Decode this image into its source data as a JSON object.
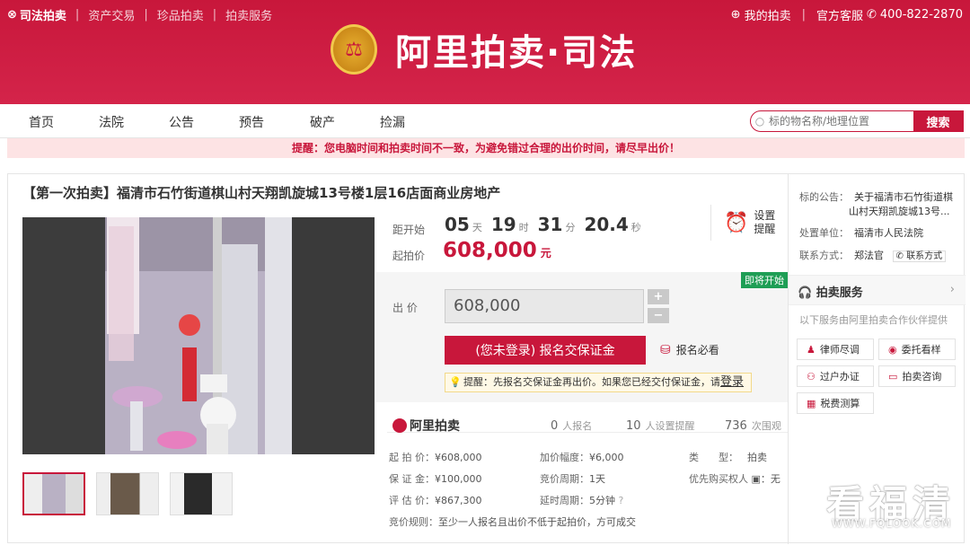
{
  "topbar": {
    "brand": "司法拍卖",
    "links": [
      "资产交易",
      "珍品拍卖",
      "拍卖服务"
    ],
    "my_auction": "我的拍卖",
    "service": "官方客服",
    "phone": "400-822-2870"
  },
  "logo": {
    "emblem": "⚖",
    "title": "阿里拍卖·司法"
  },
  "nav": [
    "首页",
    "法院",
    "公告",
    "预告",
    "破产",
    "捡漏"
  ],
  "search": {
    "placeholder": "标的物名称/地理位置",
    "button": "搜索"
  },
  "notice": "提醒：您电脑时间和拍卖时间不一致，为避免错过合理的出价时间，请尽早出价！",
  "item": {
    "title": "【第一次拍卖】福清市石竹街道棋山村天翔凯旋城13号楼1层16店面商业房地产"
  },
  "countdown": {
    "label": "距开始",
    "days": "05",
    "days_unit": "天",
    "hours": "19",
    "hours_unit": "时",
    "minutes": "31",
    "minutes_unit": "分",
    "seconds": "20.4",
    "seconds_unit": "秒"
  },
  "remind": {
    "line1": "设置",
    "line2": "提醒"
  },
  "start_price": {
    "label": "起拍价",
    "value": "608,000",
    "unit": "元"
  },
  "status_badge": "即将开始",
  "bid": {
    "label": "出 价",
    "value": "608,000",
    "plus": "+",
    "minus": "−"
  },
  "register_button": "(您未登录) 报名交保证金",
  "must_read": "报名必看",
  "tip": {
    "text": "提醒：先报名交保证金再出价。如果您已经交付保证金，请",
    "link": "登录"
  },
  "stats": {
    "logo": "阿里拍卖",
    "signups": "0",
    "signups_label": "人报名",
    "reminders": "10",
    "reminders_label": "人设置提醒",
    "views": "736",
    "views_label": "次围观"
  },
  "details": {
    "col1": [
      {
        "k": "起 拍 价：",
        "v": "¥608,000"
      },
      {
        "k": "保 证 金：",
        "v": "¥100,000"
      },
      {
        "k": "评 估 价：",
        "v": "¥867,300"
      }
    ],
    "col2": [
      {
        "k": "加价幅度：",
        "v": "¥6,000"
      },
      {
        "k": "竞价周期：",
        "v": "1天"
      },
      {
        "k": "延时周期：",
        "v": "5分钟"
      }
    ],
    "col3": [
      {
        "k": "类　　型：",
        "v": "拍卖"
      },
      {
        "k": "优先购买权人",
        "v": "：无"
      }
    ],
    "rule": {
      "k": "竞价规则：",
      "v": "至少一人报名且出价不低于起拍价，方可成交"
    }
  },
  "side": {
    "announce_k": "标的公告：",
    "announce_v1": "关于福清市石竹街道棋",
    "announce_v2": "山村天翔凯旋城13号...",
    "unit_k": "处置单位：",
    "unit_v": "福清市人民法院",
    "contact_k": "联系方式：",
    "contact_v": "郑法官",
    "contact_btn": "联系方式",
    "svc_title": "拍卖服务",
    "svc_sub": "以下服务由阿里拍卖合作伙伴提供",
    "services": [
      "律师尽调",
      "委托看样",
      "过户办证",
      "拍卖咨询",
      "税费测算"
    ]
  },
  "watermark": {
    "cn": "看福清",
    "url": "WWW.FQLOOK.COM"
  }
}
